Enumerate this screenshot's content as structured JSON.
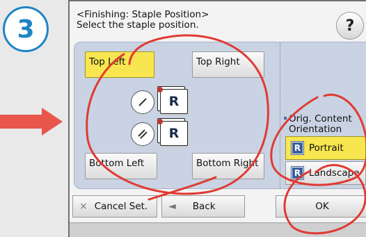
{
  "step": {
    "number": "3",
    "accent": "#1e84c6"
  },
  "arrow": {
    "color": "#e8564b"
  },
  "header": {
    "title": "<Finishing: Staple Position>",
    "subtitle": "Select the staple position.",
    "help_label": "?"
  },
  "positions": {
    "top_left": "Top Left",
    "top_right": "Top Right",
    "bottom_left": "Bottom Left",
    "bottom_right": "Bottom Right",
    "selected": "top_left"
  },
  "preview": {
    "sheet_letter": "R"
  },
  "orientation": {
    "heading_line1": "Orig. Content",
    "heading_line2": "Orientation",
    "portrait": "Portrait",
    "landscape": "Landscape",
    "icon_letter": "R",
    "selected": "portrait"
  },
  "footer": {
    "cancel_icon": "×",
    "cancel": "Cancel Set.",
    "back_icon": "◄",
    "back": "Back",
    "ok": "OK"
  },
  "colors": {
    "selected": "#f7e64f",
    "panel": "#c9d3e3",
    "annotation": "#e03a33"
  }
}
